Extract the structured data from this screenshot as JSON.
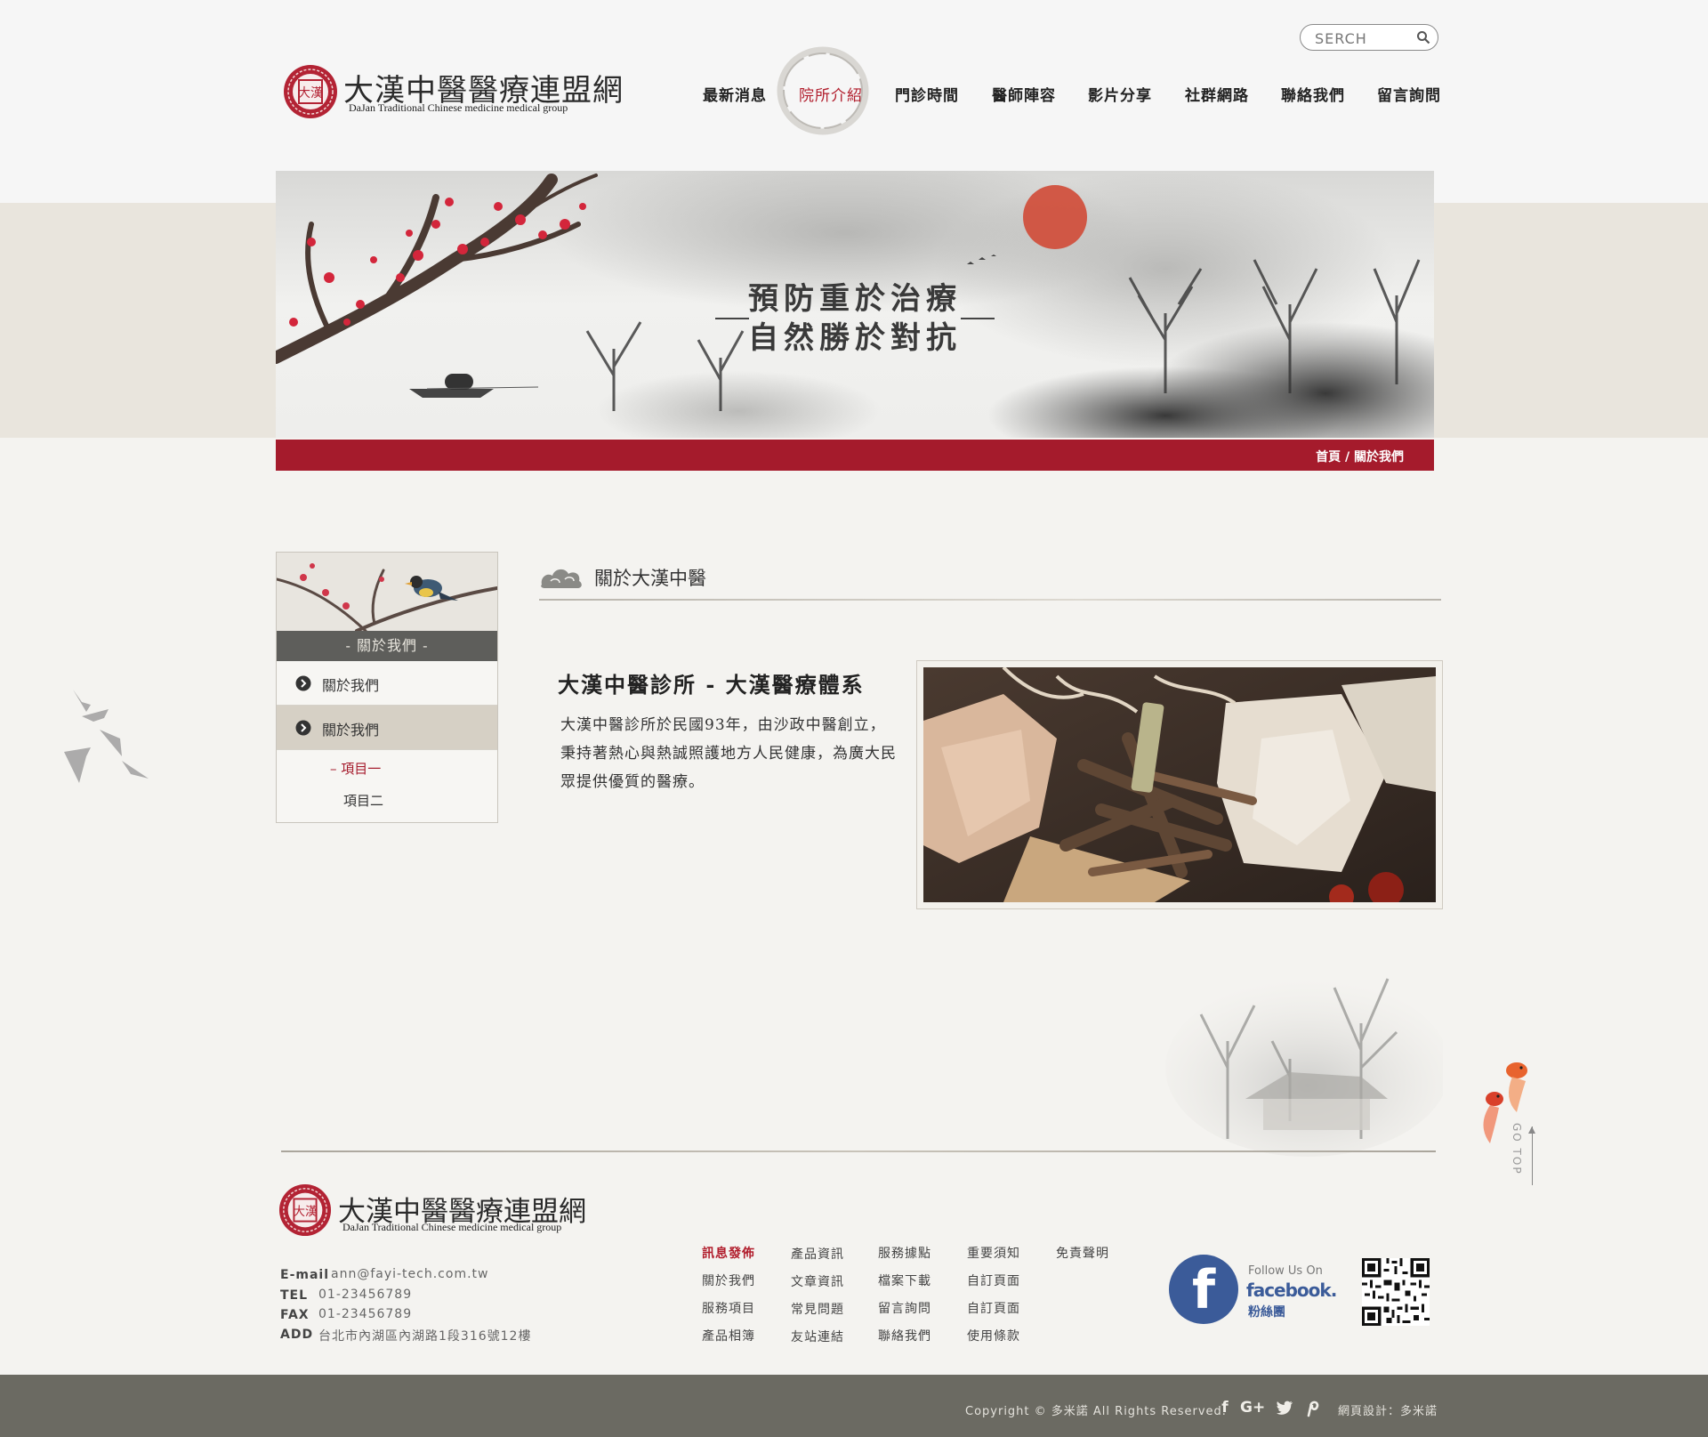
{
  "header": {
    "search_placeholder": "SERCH",
    "logo": {
      "title": "大漢中醫醫療連盟網",
      "subtitle": "DaJan Traditional Chinese medicine medical group",
      "seal_text": "大漢"
    },
    "nav": [
      {
        "label": "最新消息",
        "active": false
      },
      {
        "label": "院所介紹",
        "active": true
      },
      {
        "label": "門診時間",
        "active": false
      },
      {
        "label": "醫師陣容",
        "active": false
      },
      {
        "label": "影片分享",
        "active": false
      },
      {
        "label": "社群網路",
        "active": false
      },
      {
        "label": "聯絡我們",
        "active": false
      },
      {
        "label": "留言詢問",
        "active": false
      }
    ]
  },
  "banner": {
    "line1": "預防重於治療",
    "line2": "自然勝於對抗"
  },
  "breadcrumb": "首頁 / 關於我們",
  "sidebar": {
    "heading": "- 關於我們 -",
    "items": [
      {
        "label": "關於我們",
        "selected": false
      },
      {
        "label": "關於我們",
        "selected": true
      }
    ],
    "subitems": [
      {
        "label": "– 項目一",
        "active": true
      },
      {
        "label": "項目二",
        "active": false
      }
    ]
  },
  "main": {
    "section_title": "關於大漢中醫",
    "article_title": "大漢中醫診所 - 大漢醫療體系",
    "article_body": "大漢中醫診所於民國93年，由沙政中醫創立，秉持著熱心與熱誠照護地方人民健康，為廣大民眾提供優質的醫療。"
  },
  "go_top": "GO TOP",
  "footer": {
    "logo": {
      "title": "大漢中醫醫療連盟網",
      "subtitle": "DaJan Traditional Chinese medicine medical group",
      "seal_text": "大漢"
    },
    "contact": {
      "email_label": "E-mail",
      "email": "ann@fayi-tech.com.tw",
      "tel_label": "TEL",
      "tel": "01-23456789",
      "fax_label": "FAX",
      "fax": "01-23456789",
      "add_label": "ADD",
      "address": "台北市內湖區內湖路1段316號12樓"
    },
    "links": [
      [
        "訊息發佈",
        "關於我們",
        "服務項目",
        "產品相簿"
      ],
      [
        "產品資訊",
        "文章資訊",
        "常見問題",
        "友站連結"
      ],
      [
        "服務據點",
        "檔案下載",
        "留言詢問",
        "聯絡我們"
      ],
      [
        "重要須知",
        "自訂頁面",
        "自訂頁面",
        "使用條款"
      ],
      [
        "免責聲明"
      ]
    ],
    "facebook": {
      "follow": "Follow Us On",
      "brand": "facebook.",
      "fans": "粉絲團"
    },
    "copyright": "Copyright © 多米諾 All Rights Reserved.",
    "social": [
      "f",
      "G+",
      "twitter",
      "P"
    ],
    "designer": "網頁設計：多米諾"
  },
  "colors": {
    "accent_red": "#a51b2c",
    "bottom_bar": "#6b6a62",
    "facebook_blue": "#3b5b99"
  }
}
